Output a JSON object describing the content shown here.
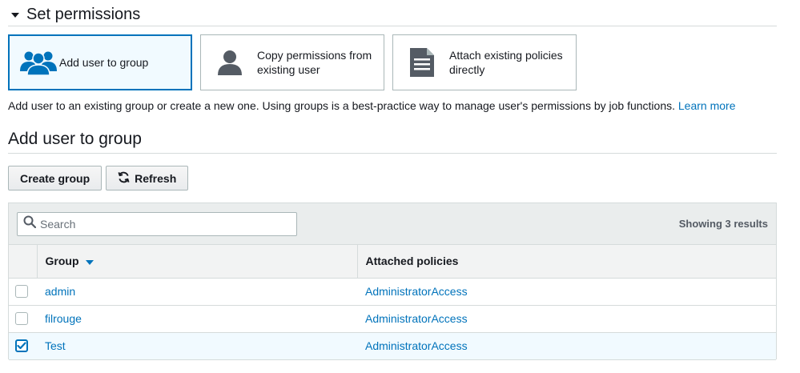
{
  "section": {
    "title": "Set permissions"
  },
  "cards": [
    {
      "label": "Add user to group",
      "icon": "users-group-icon",
      "selected": true
    },
    {
      "label": "Copy permissions from existing user",
      "icon": "user-icon",
      "selected": false
    },
    {
      "label": "Attach existing policies directly",
      "icon": "document-icon",
      "selected": false
    }
  ],
  "description": {
    "text": "Add user to an existing group or create a new one. Using groups is a best-practice way to manage user's permissions by job functions.",
    "link": "Learn more"
  },
  "subsection": {
    "title": "Add user to group"
  },
  "buttons": {
    "create_group": "Create group",
    "refresh": "Refresh"
  },
  "search": {
    "placeholder": "Search",
    "value": ""
  },
  "results": {
    "label": "Showing 3 results"
  },
  "table": {
    "columns": {
      "group": "Group",
      "policies": "Attached policies"
    },
    "sort": {
      "column": "Group",
      "direction": "descending"
    },
    "rows": [
      {
        "group": "admin",
        "policies": "AdministratorAccess",
        "checked": false
      },
      {
        "group": "filrouge",
        "policies": "AdministratorAccess",
        "checked": false
      },
      {
        "group": "Test",
        "policies": "AdministratorAccess",
        "checked": true
      }
    ]
  },
  "colors": {
    "accent": "#0073bb",
    "selected_bg": "#f1faff",
    "border": "#aab7b8",
    "icon_gray": "#545b64"
  }
}
